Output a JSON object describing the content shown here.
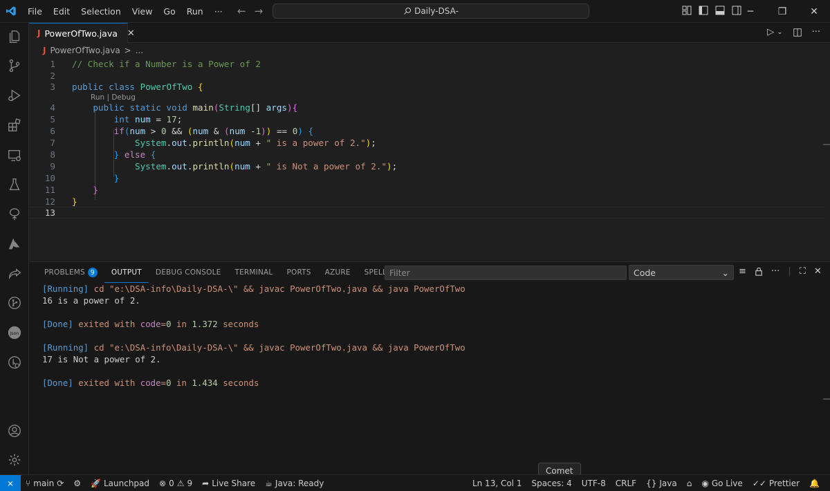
{
  "titlebar": {
    "menu": [
      "File",
      "Edit",
      "Selection",
      "View",
      "Go",
      "Run",
      "···"
    ],
    "search": "Daily-DSA-"
  },
  "tab": {
    "label": "PowerOfTwo.java",
    "icon": "J"
  },
  "breadcrumb": {
    "file": "PowerOfTwo.java",
    "sep": ">",
    "rest": "..."
  },
  "editor": {
    "line_numbers": [
      "1",
      "2",
      "3",
      "4",
      "5",
      "6",
      "7",
      "8",
      "9",
      "10",
      "11",
      "12",
      "13"
    ],
    "codelens": "Run | Debug",
    "active_line": "13"
  },
  "panel": {
    "tabs": [
      "PROBLEMS",
      "OUTPUT",
      "DEBUG CONSOLE",
      "TERMINAL",
      "PORTS",
      "AZURE",
      "SPELL CHECKER"
    ],
    "problems_count": "9",
    "filter_placeholder": "Filter",
    "output_channel": "Code",
    "output": [
      {
        "tag": "[Running]",
        "cmd": "cd \"e:\\DSA-info\\Daily-DSA-\\\" && javac PowerOfTwo.java && java PowerOfTwo"
      },
      {
        "text": "16 is a power of 2."
      },
      {},
      {
        "tag": "[Done]",
        "pre": "exited with",
        "key": "code",
        "eq": "=",
        "code": "0",
        "mid": "in",
        "time": "1.372",
        "post": "seconds"
      },
      {},
      {
        "tag": "[Running]",
        "cmd": "cd \"e:\\DSA-info\\Daily-DSA-\\\" && javac PowerOfTwo.java && java PowerOfTwo"
      },
      {
        "text": "17 is Not a power of 2."
      },
      {},
      {
        "tag": "[Done]",
        "pre": "exited with",
        "key": "code",
        "eq": "=",
        "code": "0",
        "mid": "in",
        "time": "1.434",
        "post": "seconds"
      }
    ]
  },
  "tooltip": "Comet",
  "statusbar": {
    "branch": "main",
    "launchpad": "Launchpad",
    "errors": "0",
    "warnings": "9",
    "liveshare": "Live Share",
    "java_status": "Java: Ready",
    "position": "Ln 13, Col 1",
    "spaces": "Spaces: 4",
    "encoding": "UTF-8",
    "eol": "CRLF",
    "language": "Java",
    "golive": "Go Live",
    "prettier": "Prettier"
  },
  "colors": {
    "accent": "#0078d4",
    "background": "#1f1f1f",
    "sidebar": "#181818"
  }
}
